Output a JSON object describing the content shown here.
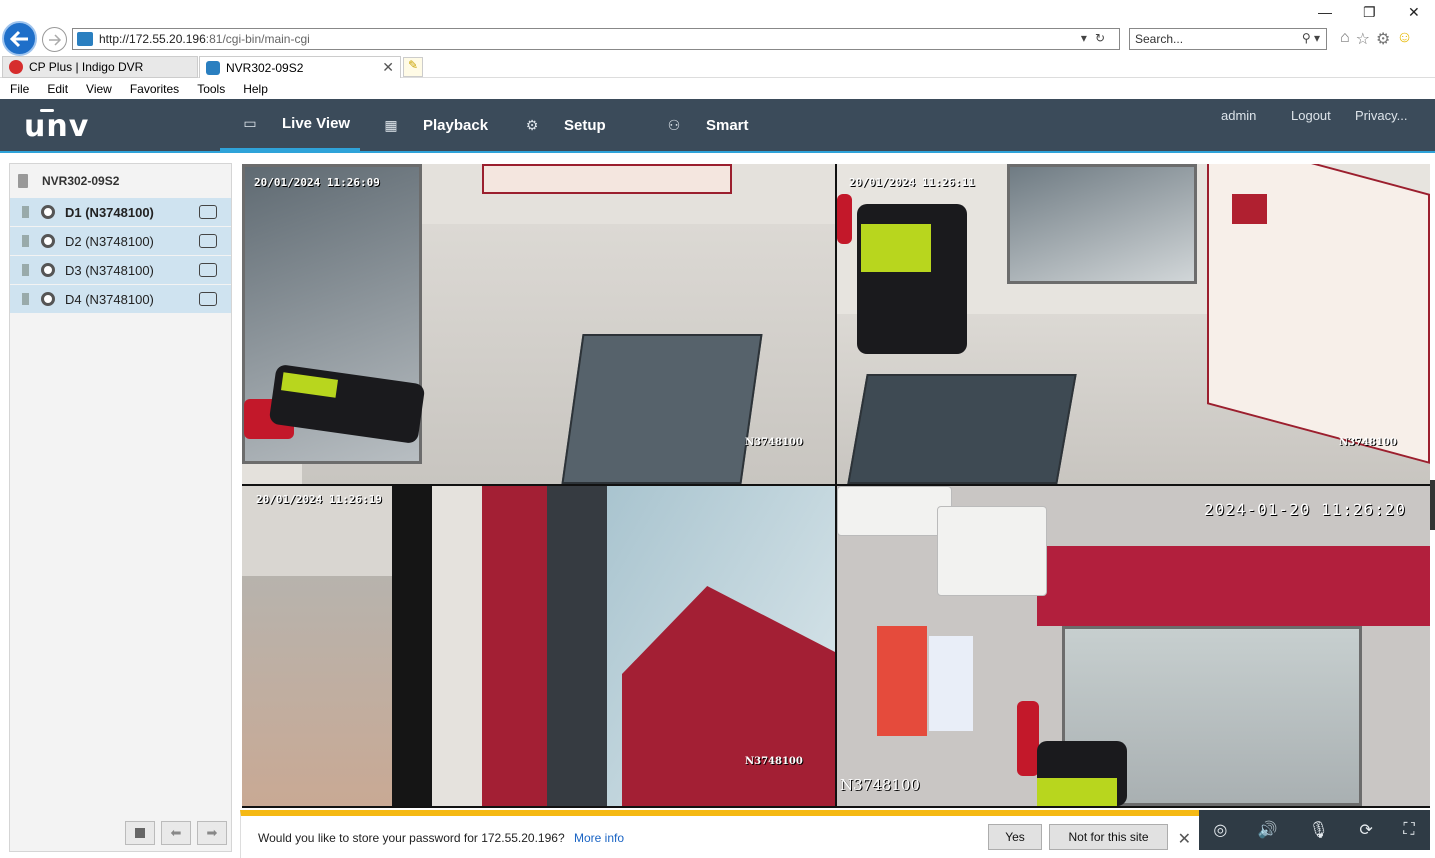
{
  "browser": {
    "url_host": "http://172.55.20.196",
    "url_port_path": ":81/cgi-bin/main-cgi",
    "search_placeholder": "Search...",
    "tabs": [
      {
        "label": "CP Plus | Indigo DVR",
        "active": false,
        "icon_color": "#d62d2d"
      },
      {
        "label": "NVR302-09S2",
        "active": true,
        "icon_color": "#2a7fc0"
      }
    ],
    "menu": [
      "File",
      "Edit",
      "View",
      "Favorites",
      "Tools",
      "Help"
    ]
  },
  "app": {
    "logo": "unv",
    "nav": [
      {
        "label": "Live View",
        "icon": "monitor-icon",
        "active": true
      },
      {
        "label": "Playback",
        "icon": "film-icon",
        "active": false
      },
      {
        "label": "Setup",
        "icon": "gear-icon",
        "active": false
      },
      {
        "label": "Smart",
        "icon": "user-search-icon",
        "active": false
      }
    ],
    "user": "admin",
    "logout": "Logout",
    "privacy": "Privacy..."
  },
  "device_tree": {
    "root": "NVR302-09S2",
    "channels": [
      {
        "label": "D1 (N3748100)",
        "selected": true
      },
      {
        "label": "D2 (N3748100)",
        "selected": false
      },
      {
        "label": "D3 (N3748100)",
        "selected": false
      },
      {
        "label": "D4 (N3748100)",
        "selected": false
      }
    ]
  },
  "cameras": [
    {
      "timestamp": "20/01/2024 11:26:09",
      "label": "N3748100"
    },
    {
      "timestamp": "20/01/2024 11:26:11",
      "label": "N3748100"
    },
    {
      "timestamp": "20/01/2024 11:26:19",
      "label": "N3748100"
    },
    {
      "timestamp": "2024-01-20 11:26:20",
      "label": "N3748100"
    }
  ],
  "password_bar": {
    "message": "Would you like to store your password for 172.55.20.196?",
    "more_info": "More info",
    "yes": "Yes",
    "not_for_site": "Not for this site"
  },
  "colors": {
    "header_bg": "#3b4b5a",
    "accent": "#2fa3d9",
    "selected_row": "#cfe3f0",
    "warning_bar": "#f5b914"
  }
}
